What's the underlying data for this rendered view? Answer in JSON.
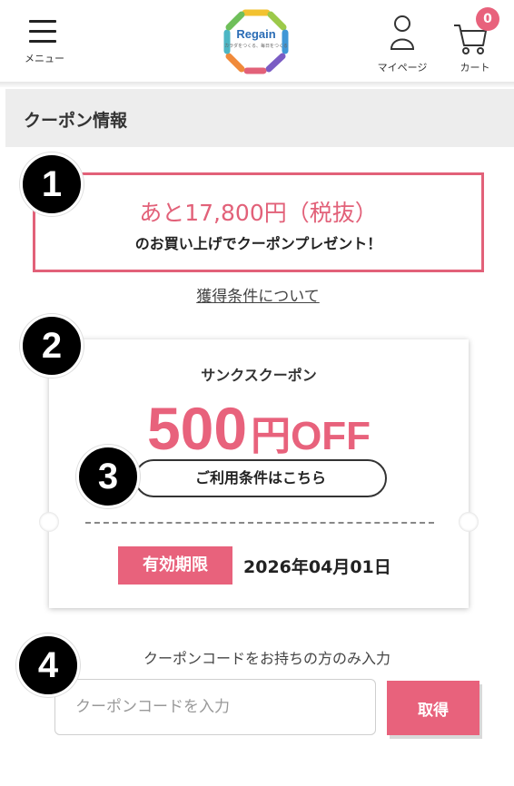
{
  "header": {
    "menu_label": "メニュー",
    "logo_text": "Regain",
    "logo_tagline": "カラダをつくる、毎日をつくる",
    "mypage_label": "マイページ",
    "cart_label": "カート",
    "cart_count": "0"
  },
  "section": {
    "title": "クーポン情報"
  },
  "steps": [
    "1",
    "2",
    "3",
    "4"
  ],
  "promo": {
    "amount_text": "あと17,800円（税抜）",
    "subtext": "のお買い上げでクーポンプレゼント！",
    "conditions_link": "獲得条件について"
  },
  "coupon": {
    "name": "サンクスクーポン",
    "amount": "500",
    "unit": "円",
    "off": "OFF",
    "usage_button": "ご利用条件はこちら",
    "expiry_label": "有効期限",
    "expiry_date": "2026年04月01日"
  },
  "code_entry": {
    "label": "クーポンコードをお持ちの方のみ入力",
    "placeholder": "クーポンコードを入力",
    "submit_label": "取得"
  },
  "colors": {
    "accent": "#e8627c",
    "section_bg": "#ededed"
  }
}
